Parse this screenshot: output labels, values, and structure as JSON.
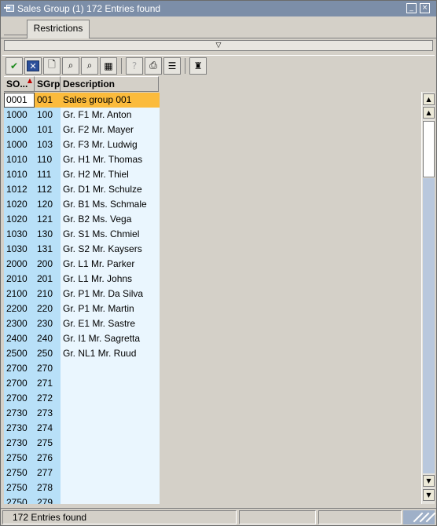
{
  "window": {
    "title": "Sales Group (1)  172 Entries found",
    "minimize_label": "_",
    "close_label": "×"
  },
  "tabs": [
    {
      "label": "Restrictions",
      "active": true
    }
  ],
  "restrictions_toggle": "▽",
  "toolbar": {
    "buttons": [
      {
        "name": "continue-button",
        "icon": "checkmark-icon",
        "glyph": "✔"
      },
      {
        "name": "cancel-button",
        "icon": "cancel-x-icon",
        "glyph": "✕"
      },
      {
        "name": "new-button",
        "icon": "new-document-icon",
        "glyph": "🗋"
      },
      {
        "name": "find-button",
        "icon": "binoculars-icon",
        "glyph": "⌕"
      },
      {
        "name": "find-next-button",
        "icon": "binoculars-plus-icon",
        "glyph": "⌕"
      },
      {
        "name": "export-button",
        "icon": "export-icon",
        "glyph": "▦"
      },
      {
        "name": "help-button",
        "icon": "help-icon",
        "glyph": "?",
        "disabled": true
      },
      {
        "name": "print-button",
        "icon": "print-icon",
        "glyph": "⎙"
      },
      {
        "name": "list-button",
        "icon": "list-icon",
        "glyph": "☰"
      },
      {
        "name": "personal-list-button",
        "icon": "personalize-icon",
        "glyph": "♜"
      }
    ]
  },
  "table": {
    "columns": [
      {
        "key": "so",
        "label": "SO..."
      },
      {
        "key": "sgrp",
        "label": "SGrp"
      },
      {
        "key": "desc",
        "label": "Description"
      }
    ],
    "sort_indicator": "▲",
    "selected_row": 0,
    "rows": [
      [
        "0001",
        "001",
        "Sales group 001"
      ],
      [
        "1000",
        "100",
        "Gr. F1 Mr. Anton"
      ],
      [
        "1000",
        "101",
        "Gr. F2 Mr. Mayer"
      ],
      [
        "1000",
        "103",
        "Gr. F3 Mr. Ludwig"
      ],
      [
        "1010",
        "110",
        "Gr. H1 Mr. Thomas"
      ],
      [
        "1010",
        "111",
        "Gr. H2 Mr. Thiel"
      ],
      [
        "1012",
        "112",
        "Gr. D1 Mr. Schulze"
      ],
      [
        "1020",
        "120",
        "Gr. B1 Ms. Schmale"
      ],
      [
        "1020",
        "121",
        "Gr. B2 Ms. Vega"
      ],
      [
        "1030",
        "130",
        "Gr. S1 Ms. Chmiel"
      ],
      [
        "1030",
        "131",
        "Gr. S2 Mr. Kaysers"
      ],
      [
        "2000",
        "200",
        "Gr. L1 Mr. Parker"
      ],
      [
        "2010",
        "201",
        "Gr. L1 Mr. Johns"
      ],
      [
        "2100",
        "210",
        "Gr. P1 Mr. Da Silva"
      ],
      [
        "2200",
        "220",
        "Gr. P1 Mr. Martin"
      ],
      [
        "2300",
        "230",
        "Gr. E1 Mr. Sastre"
      ],
      [
        "2400",
        "240",
        "Gr. I1 Mr. Sagretta"
      ],
      [
        "2500",
        "250",
        "Gr. NL1 Mr. Ruud"
      ],
      [
        "2700",
        "270",
        ""
      ],
      [
        "2700",
        "271",
        ""
      ],
      [
        "2700",
        "272",
        ""
      ],
      [
        "2730",
        "273",
        ""
      ],
      [
        "2730",
        "274",
        ""
      ],
      [
        "2730",
        "275",
        ""
      ],
      [
        "2750",
        "276",
        ""
      ],
      [
        "2750",
        "277",
        ""
      ],
      [
        "2750",
        "278",
        ""
      ],
      [
        "2750",
        "279",
        ""
      ]
    ]
  },
  "scrollbar": {
    "up": "▲",
    "down": "▼",
    "page_up": "▲",
    "page_down": "▼"
  },
  "statusbar": {
    "message": "172 Entries found"
  },
  "colors": {
    "titlebar": "#7c8ea8",
    "key_column": "#b8e0f8",
    "desc_column": "#eaf6fe",
    "selection": "#fbbb3c"
  }
}
